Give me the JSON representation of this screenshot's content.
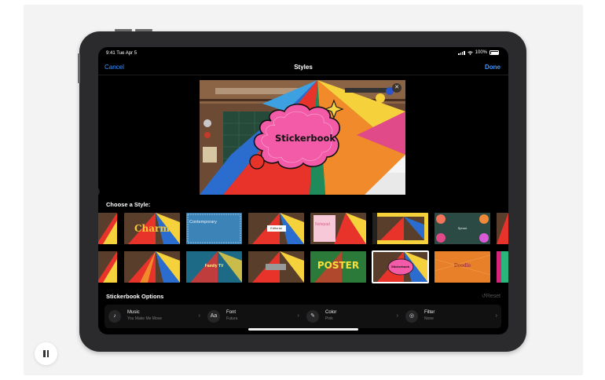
{
  "status_bar": {
    "time": "9:41",
    "date": "Tue Apr 5",
    "battery": "100%"
  },
  "nav": {
    "cancel": "Cancel",
    "title": "Styles",
    "done": "Done"
  },
  "preview": {
    "sticker_title": "Stickerbook"
  },
  "styles": {
    "heading": "Choose a Style:",
    "row1": [
      {
        "caption": ""
      },
      {
        "caption": "Charm"
      },
      {
        "caption": "Contemporary"
      },
      {
        "caption": "Editorial"
      },
      {
        "caption": "Notepad"
      },
      {
        "caption": ""
      },
      {
        "caption": "Sprout"
      },
      {
        "caption": ""
      }
    ],
    "row2": [
      {
        "caption": ""
      },
      {
        "caption": ""
      },
      {
        "caption": "Family TV"
      },
      {
        "caption": ""
      },
      {
        "caption": "POSTER"
      },
      {
        "caption": "Stickerbook"
      },
      {
        "caption": "Doodle"
      },
      {
        "caption": ""
      }
    ],
    "selected": "Stickerbook"
  },
  "options": {
    "heading": "Stickerbook Options",
    "reset": "Reset",
    "items": [
      {
        "icon": "music-icon",
        "glyph": "♪",
        "name": "Music",
        "value": "You Make Me Move"
      },
      {
        "icon": "font-icon",
        "glyph": "Aa",
        "name": "Font",
        "value": "Futura"
      },
      {
        "icon": "color-picker-icon",
        "glyph": "✎",
        "name": "Color",
        "value": "Pink"
      },
      {
        "icon": "filter-icon",
        "glyph": "◎",
        "name": "Filter",
        "value": "None"
      }
    ]
  },
  "colors": {
    "accent": "#3b94ff",
    "sticker_pink": "#f35aa8",
    "sticker_yellow": "#f7d54a",
    "sticker_red": "#e8332a"
  }
}
